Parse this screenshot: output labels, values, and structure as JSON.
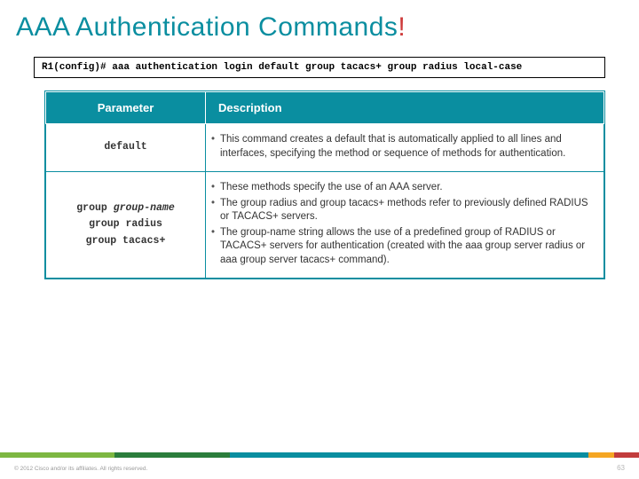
{
  "title": "AAA Authentication Commands",
  "title_bang": "!",
  "command_line": "R1(config)# aaa authentication login default group tacacs+ group radius local-case",
  "table": {
    "headers": [
      "Parameter",
      "Description"
    ],
    "rows": [
      {
        "param_lines": [
          "default"
        ],
        "bullets": [
          "This command creates a default that is automatically applied to all lines and interfaces, specifying the method or sequence of methods for authentication."
        ]
      },
      {
        "param_lines": [
          "group group-name",
          "group radius",
          "group tacacs+"
        ],
        "param_italic_tokens": [
          "group-name"
        ],
        "bullets": [
          "These methods specify the use of an AAA server.",
          "The group radius and group tacacs+ methods refer to previously defined RADIUS or TACACS+ servers.",
          "The group-name string allows the use of a predefined group of RADIUS or TACACS+ servers for authentication (created with the aaa group server radius or aaa group server tacacs+ command)."
        ]
      }
    ]
  },
  "copyright": "© 2012 Cisco and/or its affiliates. All rights reserved.",
  "page_number": "63"
}
